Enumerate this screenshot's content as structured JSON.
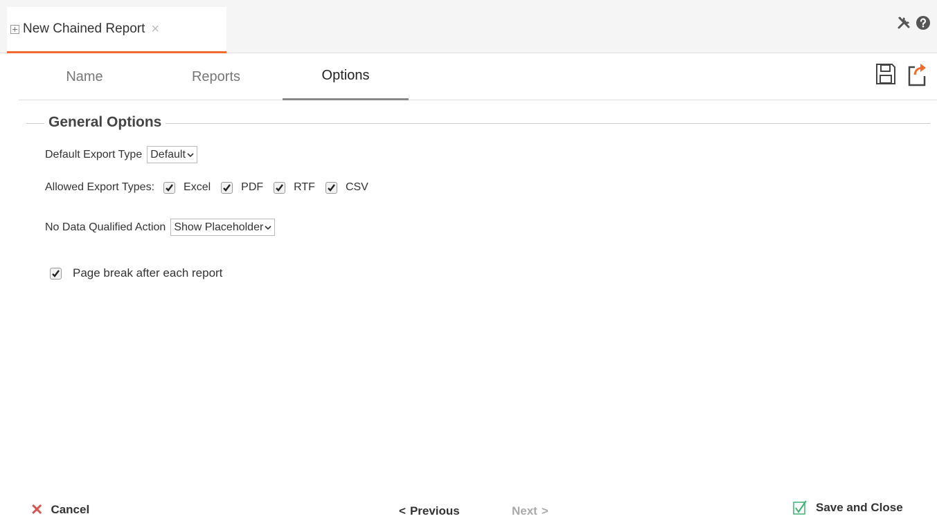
{
  "document_tab": {
    "title": "New Chained Report",
    "close": "×"
  },
  "step_tabs": [
    {
      "label": "Name"
    },
    {
      "label": "Reports"
    },
    {
      "label": "Options"
    }
  ],
  "general_options": {
    "title": "General Options",
    "default_export_type": {
      "label": "Default Export Type",
      "value": "Default"
    },
    "allowed_export_types": {
      "label": "Allowed Export Types:",
      "types": [
        {
          "label": "Excel",
          "checked": true
        },
        {
          "label": "PDF",
          "checked": true
        },
        {
          "label": "RTF",
          "checked": true
        },
        {
          "label": "CSV",
          "checked": true
        }
      ]
    },
    "no_data_action": {
      "label": "No Data Qualified Action",
      "value": "Show Placeholder"
    },
    "page_break": {
      "label": "Page break after each report",
      "checked": true
    }
  },
  "footer": {
    "cancel": "Cancel",
    "previous": "Previous",
    "next": "Next",
    "save_and_close": "Save and Close"
  },
  "colors": {
    "accent": "#f26a2e",
    "cancel": "#d9534f",
    "save_check": "#3cb371"
  },
  "icons": [
    "tools-icon",
    "help-icon",
    "save-icon",
    "export-icon"
  ]
}
